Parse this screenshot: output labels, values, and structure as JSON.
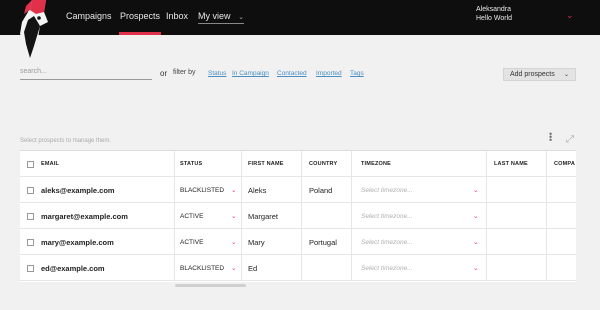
{
  "nav": {
    "items": [
      "Campaigns",
      "Prospects",
      "Inbox"
    ],
    "active": "Prospects",
    "view_label": "My view"
  },
  "user": {
    "name": "Aleksandra",
    "org": "Hello World"
  },
  "toolbar": {
    "search_placeholder": "search...",
    "or": "or",
    "filter_by": "filter by",
    "filters": [
      "Status",
      "In Campaign",
      "Contacted",
      "Imported",
      "Tags"
    ],
    "add_label": "Add prospects"
  },
  "hint": "Select prospects to manage them.",
  "table": {
    "headers": [
      "EMAIL",
      "STATUS",
      "FIRST NAME",
      "COUNTRY",
      "TIMEZONE",
      "LAST NAME",
      "COMPA"
    ],
    "timezone_placeholder": "Select timezone...",
    "rows": [
      {
        "email": "aleks@example.com",
        "status": "BLACKLISTED",
        "first": "Aleks",
        "country": "Poland"
      },
      {
        "email": "margaret@example.com",
        "status": "ACTIVE",
        "first": "Margaret",
        "country": ""
      },
      {
        "email": "mary@example.com",
        "status": "ACTIVE",
        "first": "Mary",
        "country": "Portugal"
      },
      {
        "email": "ed@example.com",
        "status": "BLACKLISTED",
        "first": "Ed",
        "country": ""
      }
    ]
  },
  "colors": {
    "accent": "#e0304a",
    "topbar": "#0e0e0e",
    "link": "#4a8ec2"
  },
  "icons": [
    "woodpecker-logo",
    "chevron-down-icon",
    "kebab-icon",
    "expand-icon"
  ]
}
